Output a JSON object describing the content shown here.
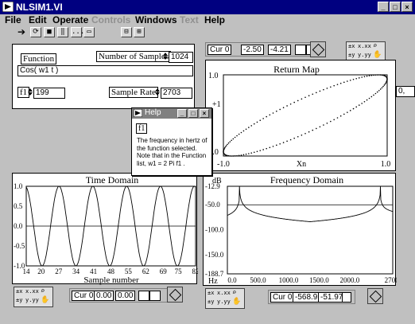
{
  "window": {
    "title": "NLSIM1.VI"
  },
  "menu": [
    {
      "label": "File",
      "enabled": true
    },
    {
      "label": "Edit",
      "enabled": true
    },
    {
      "label": "Operate",
      "enabled": true
    },
    {
      "label": "Controls",
      "enabled": false
    },
    {
      "label": "Windows",
      "enabled": true
    },
    {
      "label": "Text",
      "enabled": false
    },
    {
      "label": "Help",
      "enabled": true
    }
  ],
  "toolbar": {
    "ellipsis": "..."
  },
  "controls": {
    "function_label": "Function",
    "function_value": "Cos( w1 t )",
    "samples_label": "Number of Samples",
    "samples_value": "1024",
    "f1_label": "f1",
    "f1_value": "199",
    "rate_label": "Sample Rate",
    "rate_value": "2703"
  },
  "return_map": {
    "title": "Return Map",
    "cursor": {
      "name": "Cur 0",
      "x": "-2.50",
      "y": "-4.21"
    },
    "y_ticks": [
      "1.0",
      "+1",
      "-1.0"
    ],
    "x_ticks": [
      "-1.0",
      "Xn",
      "1.0"
    ],
    "side_value": "0,"
  },
  "time_domain": {
    "title": "Time Domain",
    "y_ticks": [
      "1.0",
      "0.5",
      "0.0",
      "-0.5",
      "-1.0"
    ],
    "x_ticks": [
      "14",
      "20",
      "27",
      "34",
      "41",
      "48",
      "55",
      "62",
      "69",
      "75",
      "82"
    ],
    "xlabel": "Sample number",
    "cursor": {
      "name": "Cur 0",
      "x": "0.00",
      "y": "0.00"
    }
  },
  "freq_domain": {
    "title": "Frequency Domain",
    "unit": "dB",
    "x_unit": "Hz",
    "y_ticks": [
      "-12.9",
      "-50.0",
      "-100.0",
      "-150.0",
      "-188.7"
    ],
    "x_ticks": [
      "0.0",
      "500.0",
      "1000.0",
      "1500.0",
      "2000.0",
      "2700."
    ],
    "cursor": {
      "name": "Cur 0",
      "x": "-568.9",
      "y": "-51.97"
    }
  },
  "help_window": {
    "title": "Help",
    "tag": "f1",
    "text": "The frequency in hertz of the function selected. Note that in the Function list, w1 = 2 Pi f1 ."
  },
  "chart_data": [
    {
      "type": "scatter",
      "title": "Return Map",
      "xlim": [
        -1,
        1
      ],
      "ylim": [
        -1,
        1
      ],
      "xlabel": "Xn",
      "ylabel": "+1"
    },
    {
      "type": "line",
      "title": "Time Domain",
      "xlabel": "Sample number",
      "xlim": [
        14,
        82
      ],
      "ylim": [
        -1,
        1
      ],
      "x_ticks": [
        14,
        20,
        27,
        34,
        41,
        48,
        55,
        62,
        69,
        75,
        82
      ],
      "series": [
        {
          "frequency_hz": 199,
          "sample_rate": 2703
        }
      ]
    },
    {
      "type": "line",
      "title": "Frequency Domain",
      "xlabel": "Hz",
      "ylabel": "dB",
      "xlim": [
        0,
        2703
      ],
      "ylim": [
        -188.7,
        -12.9
      ],
      "x_ticks": [
        0,
        500,
        1000,
        1500,
        2000,
        2700
      ],
      "y_ticks": [
        -12.9,
        -50,
        -100,
        -150,
        -188.7
      ],
      "peaks_hz": [
        199,
        2504
      ],
      "reference_line_db": -50
    }
  ]
}
